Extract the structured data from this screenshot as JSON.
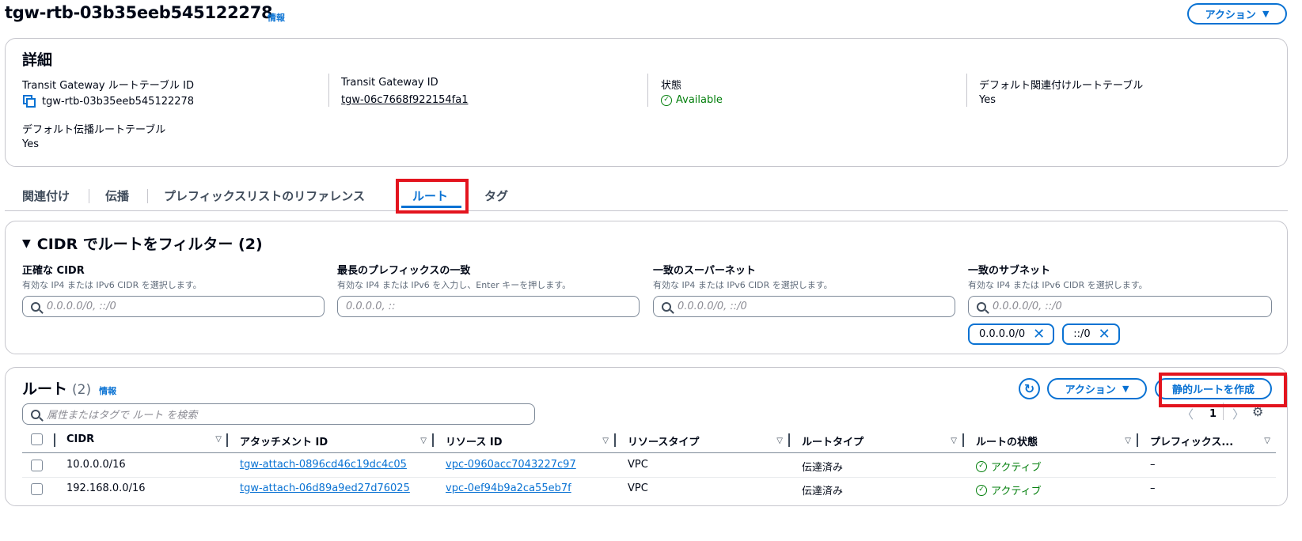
{
  "header": {
    "title": "tgw-rtb-03b35eeb545122278",
    "info": "情報",
    "action_button": "アクション"
  },
  "details": {
    "title": "詳細",
    "rtb_id_label": "Transit Gateway ルートテーブル ID",
    "rtb_id_value": "tgw-rtb-03b35eeb545122278",
    "tgw_id_label": "Transit Gateway ID",
    "tgw_id_value": "tgw-06c7668f922154fa1",
    "state_label": "状態",
    "state_value": "Available",
    "default_assoc_label": "デフォルト関連付けルートテーブル",
    "default_assoc_value": "Yes",
    "default_prop_label": "デフォルト伝播ルートテーブル",
    "default_prop_value": "Yes"
  },
  "tabs": [
    {
      "label": "関連付け"
    },
    {
      "label": "伝播"
    },
    {
      "label": "プレフィックスリストのリファレンス"
    },
    {
      "label": "ルート"
    },
    {
      "label": "タグ"
    }
  ],
  "filter": {
    "title": "CIDR でルートをフィルター (2)",
    "fields": [
      {
        "label": "正確な CIDR",
        "desc": "有効な IP4 または IPv6 CIDR を選択します。",
        "placeholder": "0.0.0.0/0, ::/0"
      },
      {
        "label": "最長のプレフィックスの一致",
        "desc": "有効な IP4 または IPv6 を入力し、Enter キーを押します。",
        "placeholder": "0.0.0.0, ::"
      },
      {
        "label": "一致のスーパーネット",
        "desc": "有効な IP4 または IPv6 CIDR を選択します。",
        "placeholder": "0.0.0.0/0, ::/0"
      },
      {
        "label": "一致のサブネット",
        "desc": "有効な IP4 または IPv6 CIDR を選択します。",
        "placeholder": "0.0.0.0/0, ::/0"
      }
    ],
    "tokens": [
      "0.0.0.0/0",
      "::/0"
    ]
  },
  "routes": {
    "title": "ルート",
    "count": "(2)",
    "info": "情報",
    "action_button": "アクション",
    "create_button": "静的ルートを作成",
    "search_placeholder": "属性またはタグで ルート を検索",
    "page": "1",
    "columns": [
      "CIDR",
      "アタッチメント ID",
      "リソース ID",
      "リソースタイプ",
      "ルートタイプ",
      "ルートの状態",
      "プレフィックス..."
    ],
    "rows": [
      {
        "cidr": "10.0.0.0/16",
        "attachment": "tgw-attach-0896cd46c19dc4c05",
        "resource": "vpc-0960acc7043227c97",
        "type": "VPC",
        "route_type": "伝達済み",
        "state": "アクティブ",
        "prefix": "–"
      },
      {
        "cidr": "192.168.0.0/16",
        "attachment": "tgw-attach-06d89a9ed27d76025",
        "resource": "vpc-0ef94b9a2ca55eb7f",
        "type": "VPC",
        "route_type": "伝達済み",
        "state": "アクティブ",
        "prefix": "–"
      }
    ]
  },
  "colors": {
    "link": "#0972d3",
    "success": "#037f0c",
    "highlight": "#e3141e"
  }
}
